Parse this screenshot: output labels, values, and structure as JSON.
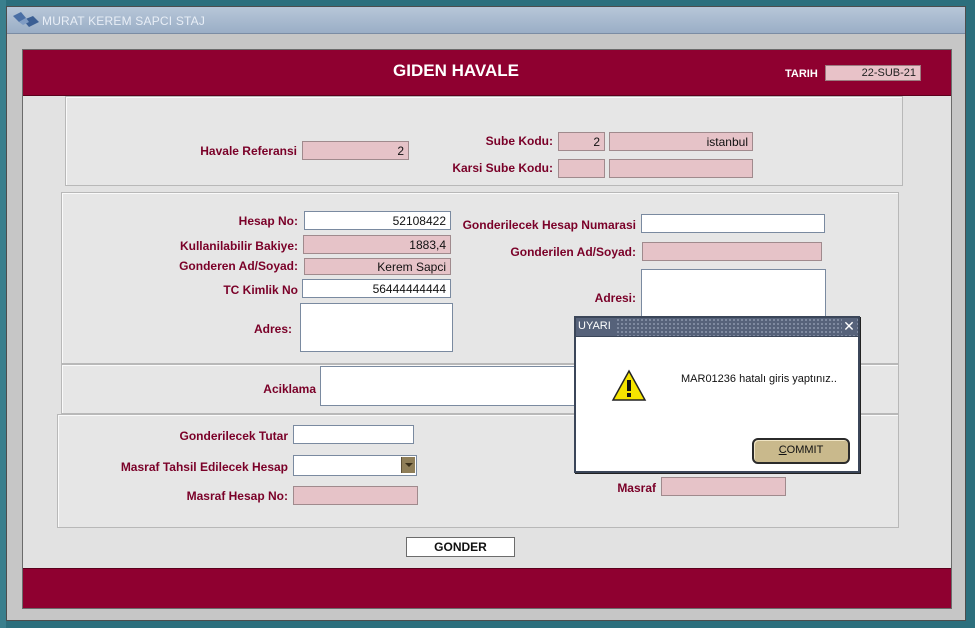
{
  "window": {
    "title": "MURAT KEREM SAPCI STAJ"
  },
  "header": {
    "title": "GIDEN HAVALE",
    "date_label": "TARIH",
    "date_value": "22-SUB-21"
  },
  "reference_panel": {
    "havale_ref_label": "Havale Referansi",
    "havale_ref_value": "2",
    "sube_kodu_label": "Sube Kodu:",
    "sube_kodu_value": "2",
    "sube_name_value": "istanbul",
    "karsi_sube_label": "Karsi Sube Kodu:",
    "karsi_sube_value": "",
    "karsi_sube_name_value": ""
  },
  "sender_panel": {
    "hesap_no_label": "Hesap No:",
    "hesap_no_value": "52108422",
    "bakiye_label": "Kullanilabilir Bakiye:",
    "bakiye_value": "1883,4",
    "gonderen_label": "Gonderen Ad/Soyad:",
    "gonderen_value": "Kerem Sapci",
    "tc_label": "TC Kimlik No",
    "tc_value": "56444444444",
    "adres_label": "Adres:",
    "target_hesap_label": "Gonderilecek Hesap Numarasi",
    "target_hesap_value": "",
    "target_name_label": "Gonderilen Ad/Soyad:",
    "target_name_value": "",
    "target_adres_label": "Adresi:"
  },
  "description_panel": {
    "aciklama_label": "Aciklama"
  },
  "amount_panel": {
    "tutar_label": "Gonderilecek Tutar",
    "tutar_value": "",
    "masraf_hesap_label": "Masraf Tahsil Edilecek Hesap",
    "masraf_hesap_value": "",
    "masraf_hesap_no_label": "Masraf Hesap No:",
    "masraf_hesap_no_value": "",
    "masraf_label": "Masraf",
    "masraf_value": ""
  },
  "actions": {
    "send_label": "GONDER"
  },
  "dialog": {
    "title": "UYARI",
    "message": "MAR01236 hatalı giris yaptınız..",
    "commit_first": "C",
    "commit_rest": "OMMIT"
  },
  "colors": {
    "brand": "#8f0030",
    "readonly_field": "#e6c3c8",
    "label_text": "#7a0028"
  },
  "icons": [
    "app-logo-icon",
    "warning-icon",
    "close-icon",
    "chevron-down-icon"
  ]
}
